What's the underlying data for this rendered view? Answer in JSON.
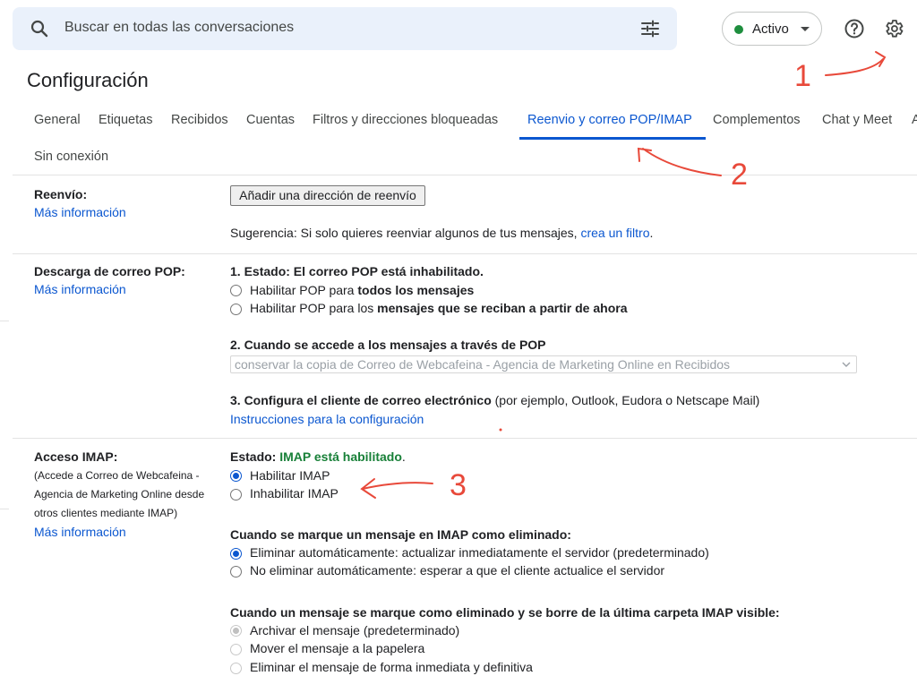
{
  "search": {
    "placeholder": "Buscar en todas las conversaciones"
  },
  "status": {
    "label": "Activo",
    "color": "#1e8e3e"
  },
  "page_title": "Configuración",
  "tabs": [
    "General",
    "Etiquetas",
    "Recibidos",
    "Cuentas",
    "Filtros y direcciones bloqueadas",
    "Reenvio y correo POP/IMAP",
    "Complementos",
    "Chat y Meet",
    "A",
    "Sin conexión"
  ],
  "forwarding": {
    "title": "Reenvío:",
    "more": "Más información",
    "button": "Añadir una dirección de reenvío",
    "tip_prefix": "Sugerencia: Si solo quieres reenviar algunos de tus mensajes, ",
    "tip_link": "crea un filtro",
    "tip_suffix": "."
  },
  "pop": {
    "title": "Descarga de correo POP:",
    "more": "Más información",
    "status": "1. Estado: El correo POP está inhabilitado.",
    "opt1_prefix": "Habilitar POP para ",
    "opt1_bold": "todos los mensajes",
    "opt2_prefix": "Habilitar POP para los ",
    "opt2_bold": "mensajes que se reciban a partir de ahora",
    "access_title": "2. Cuando se accede a los mensajes a través de POP",
    "select_value": "conservar la copia de Correo de Webcafeina - Agencia de Marketing Online en Recibidos",
    "client_title": "3. Configura el cliente de correo electrónico",
    "client_suffix": " (por ejemplo, Outlook, Eudora o Netscape Mail)",
    "instructions": "Instrucciones para la configuración"
  },
  "imap": {
    "title": "Acceso IMAP:",
    "desc1": "(Accede a Correo de Webcafeina -",
    "desc2": "Agencia de Marketing Online desde",
    "desc3": "otros clientes mediante IMAP)",
    "more": "Más información",
    "status_label": "Estado: ",
    "status_value": "IMAP está habilitado",
    "status_suffix": ".",
    "enable": "Habilitar IMAP",
    "disable": "Inhabilitar IMAP",
    "deleted_title": "Cuando se marque un mensaje en IMAP como eliminado:",
    "auto_expunge_on": "Eliminar automáticamente: actualizar inmediatamente el servidor (predeterminado)",
    "auto_expunge_off": "No eliminar automáticamente: esperar a que el cliente actualice el servidor",
    "expunged_title": "Cuando un mensaje se marque como eliminado y se borre de la última carpeta IMAP visible:",
    "archive": "Archivar el mensaje (predeterminado)",
    "trash": "Mover el mensaje a la papelera",
    "delete_forever": "Eliminar el mensaje de forma inmediata y definitiva"
  },
  "annotations": {
    "one": "1",
    "two": "2",
    "three": "3",
    "color": "#e8493a"
  },
  "colors": {
    "accent": "#0b57d0",
    "search_bg": "#eaf1fb",
    "enabled_green": "#188038"
  }
}
